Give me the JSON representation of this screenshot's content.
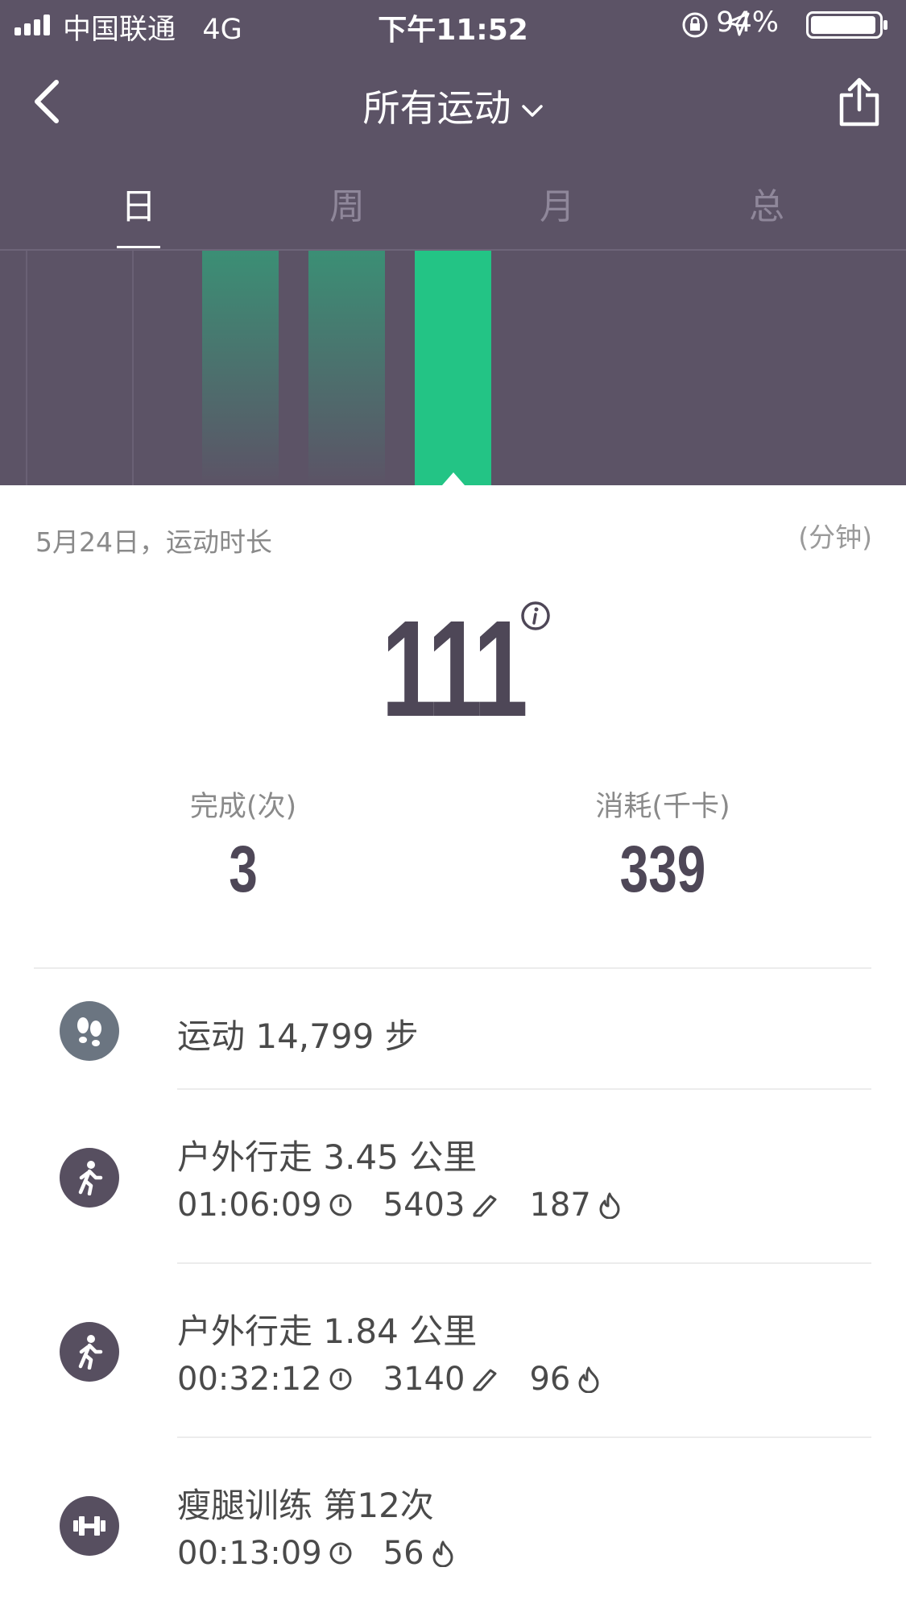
{
  "status_bar": {
    "carrier": "中国联通",
    "network": "4G",
    "time": "下午11:52",
    "battery": "94%"
  },
  "nav": {
    "title": "所有运动"
  },
  "tabs": [
    {
      "label": "日",
      "active": true
    },
    {
      "label": "周",
      "active": false
    },
    {
      "label": "月",
      "active": false
    },
    {
      "label": "总",
      "active": false
    }
  ],
  "summary": {
    "date_label": "5月24日，运动时长",
    "unit": "(分钟)",
    "duration": "111",
    "completed_label": "完成(次)",
    "completed_value": "3",
    "calories_label": "消耗(千卡)",
    "calories_value": "339"
  },
  "activities": [
    {
      "icon": "footprints-icon",
      "title": "运动 14,799 步",
      "bg": "#6b7581"
    },
    {
      "icon": "walking-icon",
      "title": "户外行走 3.45 公里",
      "time": "01:06:09",
      "steps": "5403",
      "kcal": "187",
      "bg": "#574f60"
    },
    {
      "icon": "walking-icon",
      "title": "户外行走 1.84 公里",
      "time": "00:32:12",
      "steps": "3140",
      "kcal": "96",
      "bg": "#574f60"
    },
    {
      "icon": "dumbbell-icon",
      "title": "瘦腿训练  第12次",
      "time": "00:13:09",
      "kcal": "56",
      "bg": "#574f60"
    }
  ],
  "colors": {
    "header_bg": "#5c5366",
    "bar_active": "#23c485",
    "bar_inactive": "#3b8a72",
    "text_dark": "#4e4757"
  }
}
